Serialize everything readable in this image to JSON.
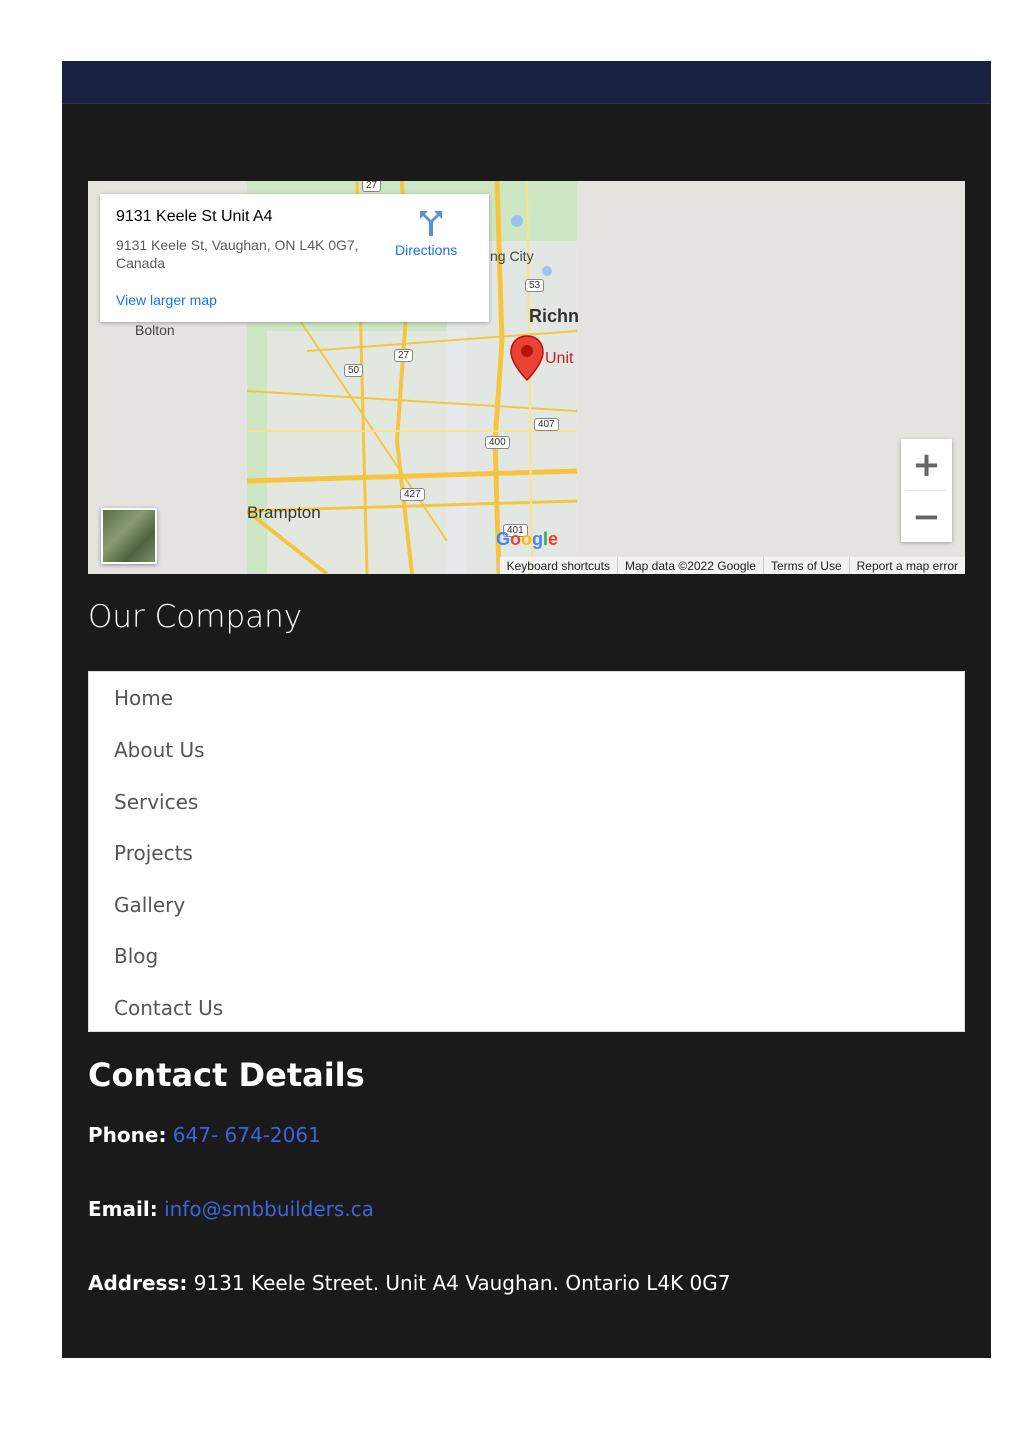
{
  "map": {
    "place_title": "9131 Keele St Unit A4",
    "place_address": "9131 Keele St, Vaughan, ON L4K 0G7, Canada",
    "directions_label": "Directions",
    "view_larger_label": "View larger map",
    "labels": {
      "bolton": "Bolton",
      "brampton": "Brampton",
      "king_city": "ng City",
      "richmond": "Richn",
      "unit": "Unit",
      "route_27_top": "27",
      "route_27": "27",
      "route_50": "50",
      "route_53": "53",
      "route_407": "407",
      "route_400": "400",
      "route_427": "427",
      "route_401": "401"
    },
    "google_logo": "Google",
    "attribution": {
      "keyboard": "Keyboard shortcuts",
      "data": "Map data ©2022 Google",
      "terms": "Terms of Use",
      "report": "Report a map error"
    },
    "zoom_in": "+",
    "zoom_out": "−"
  },
  "company": {
    "title": "Our Company",
    "menu": [
      "Home",
      "About Us",
      "Services",
      "Projects",
      "Gallery",
      "Blog",
      "Contact Us"
    ]
  },
  "contact": {
    "title": "Contact Details",
    "phone_label": "Phone:",
    "phone_value": "647- 674-2061",
    "email_label": "Email:",
    "email_value": "info@smbbuilders.ca",
    "address_label": "Address:",
    "address_value": "9131 Keele Street. Unit A4 Vaughan. Ontario L4K 0G7"
  },
  "colors": {
    "header": "#18223f",
    "panel": "#1a1a1a",
    "link": "#3d63dd"
  }
}
